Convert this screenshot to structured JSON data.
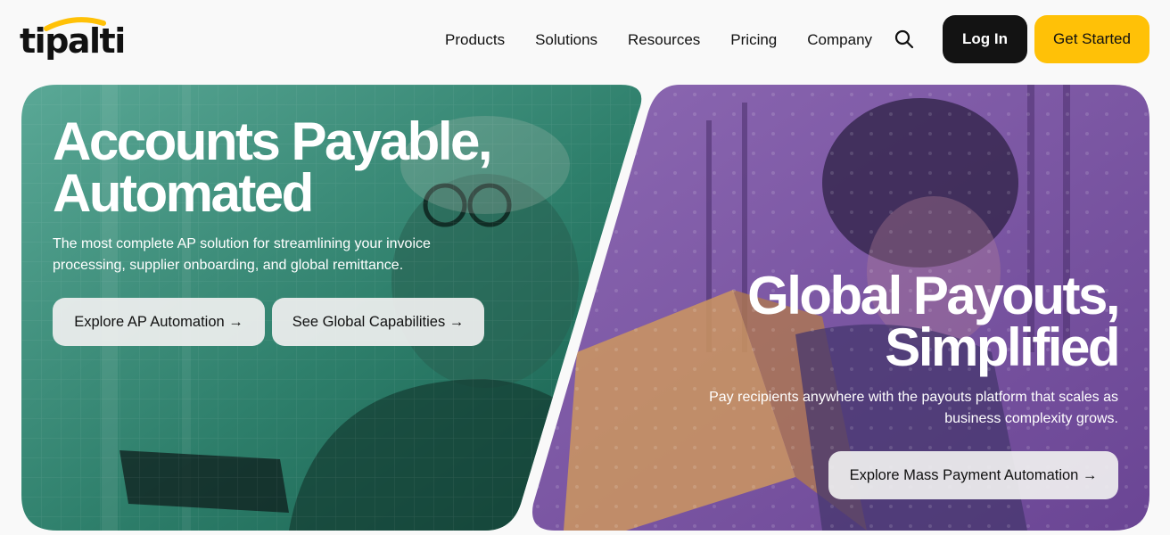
{
  "header": {
    "logo_text": "tipalti",
    "nav": [
      "Products",
      "Solutions",
      "Resources",
      "Pricing",
      "Company"
    ],
    "login_label": "Log In",
    "start_label": "Get Started"
  },
  "left_panel": {
    "title_line1": "Accounts Payable,",
    "title_line2": "Automated",
    "subtitle": "The most complete AP solution for streamlining your invoice processing, supplier onboarding, and global remittance.",
    "button1": "Explore AP Automation →",
    "button2": "See Global Capabilities →"
  },
  "right_panel": {
    "title_line1": "Global Payouts,",
    "title_line2": "Simplified",
    "subtitle": "Pay recipients anywhere with the payouts platform that scales as business complexity grows.",
    "button": "Explore Mass Payment Automation →"
  },
  "colors": {
    "accent_yellow": "#ffc107",
    "login_black": "#131313",
    "left_overlay": "#2f8a72",
    "right_overlay": "#7a4fa0"
  },
  "icons": [
    "search-icon",
    "logo-arc-icon"
  ]
}
